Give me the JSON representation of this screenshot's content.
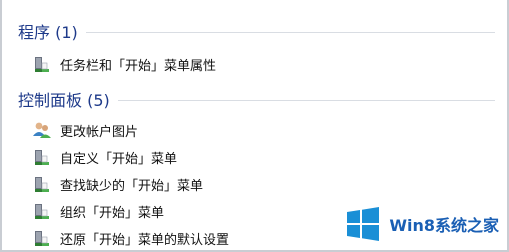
{
  "groups": [
    {
      "title": "程序 (1)",
      "items": [
        {
          "label": "任务栏和「开始」菜单属性",
          "icon": "taskbar-properties-icon"
        }
      ]
    },
    {
      "title": "控制面板 (5)",
      "items": [
        {
          "label": "更改帐户图片",
          "icon": "user-accounts-icon"
        },
        {
          "label": "自定义「开始」菜单",
          "icon": "taskbar-properties-icon"
        },
        {
          "label": "查找缺少的「开始」菜单",
          "icon": "taskbar-properties-icon"
        },
        {
          "label": "组织「开始」菜单",
          "icon": "taskbar-properties-icon"
        },
        {
          "label": "还原「开始」菜单的默认设置",
          "icon": "taskbar-properties-icon"
        }
      ]
    }
  ],
  "watermark": {
    "text": "Win8系统之家",
    "color": "#1a5fb4"
  },
  "colors": {
    "group_title": "#1e3a8a",
    "separator": "#d9dde3"
  }
}
